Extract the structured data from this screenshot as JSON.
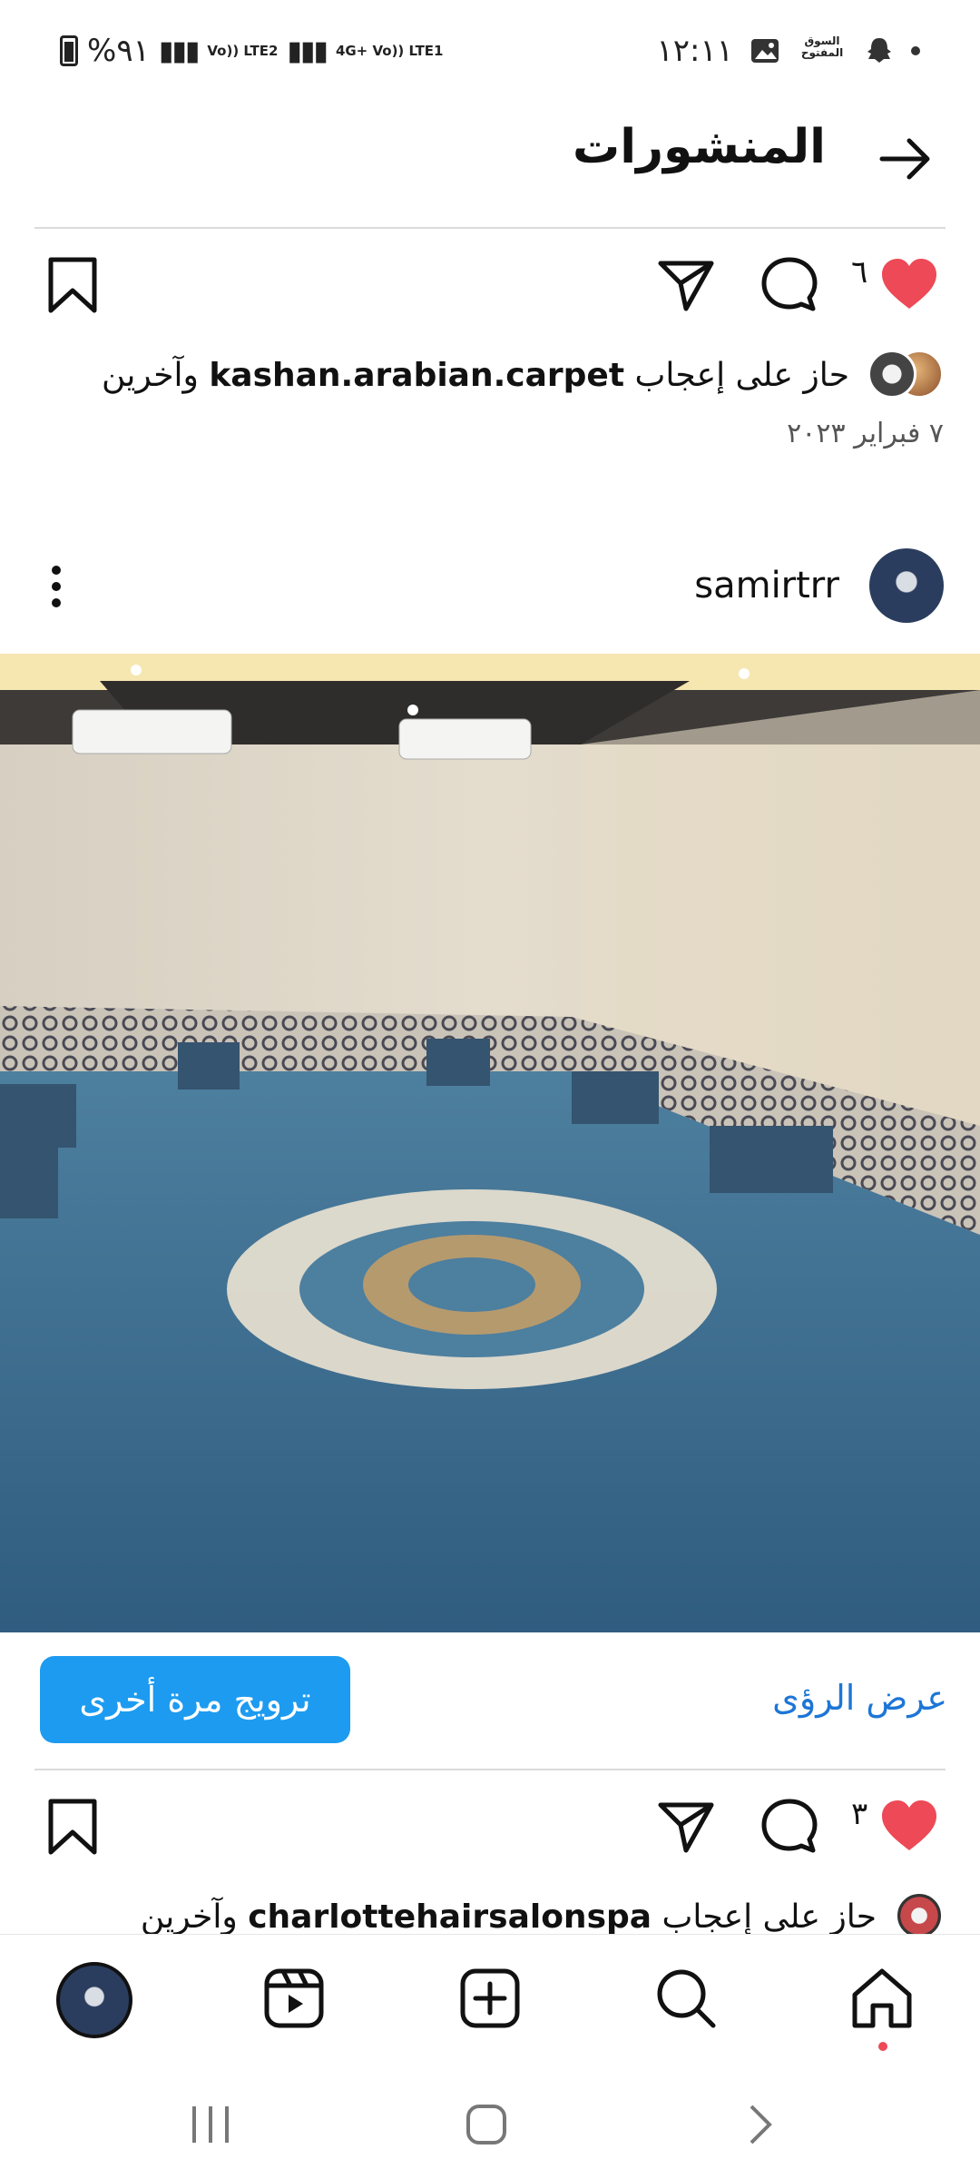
{
  "status_bar": {
    "time": "١٢:١١",
    "battery": "%٩١",
    "net1": "Vo)) LTE2",
    "net2": "4G+ Vo)) LTE1",
    "market_label": "السوق المفتوح"
  },
  "header": {
    "title": "المنشورات"
  },
  "prev_post": {
    "like_count": "٦",
    "likes_prefix": "حاز على إعجاب",
    "liked_by": "kashan.arabian.carpet",
    "likes_suffix": "وآخرين",
    "date": "٧ فبراير ٢٠٢٣"
  },
  "post": {
    "username": "samirtrr",
    "promote_label": "ترويج مرة أخرى",
    "insights_label": "عرض الرؤى",
    "like_count": "٣",
    "likes_prefix": "حاز على إعجاب",
    "liked_by": "charlottehairsalonspa",
    "likes_suffix": "وآخرين"
  },
  "colors": {
    "like_red": "#ed4956",
    "promote_blue": "#1d9bf0",
    "link_blue": "#1d76d6",
    "carpet_blue": "#3d6f93"
  },
  "icons": {
    "back": "arrow-right-icon",
    "like": "heart-filled-icon",
    "comment": "comment-bubble-icon",
    "share": "paper-plane-icon",
    "save": "bookmark-icon",
    "more": "kebab-icon",
    "nav": [
      "profile-avatar",
      "reels-icon",
      "create-icon",
      "search-icon",
      "home-icon"
    ]
  }
}
